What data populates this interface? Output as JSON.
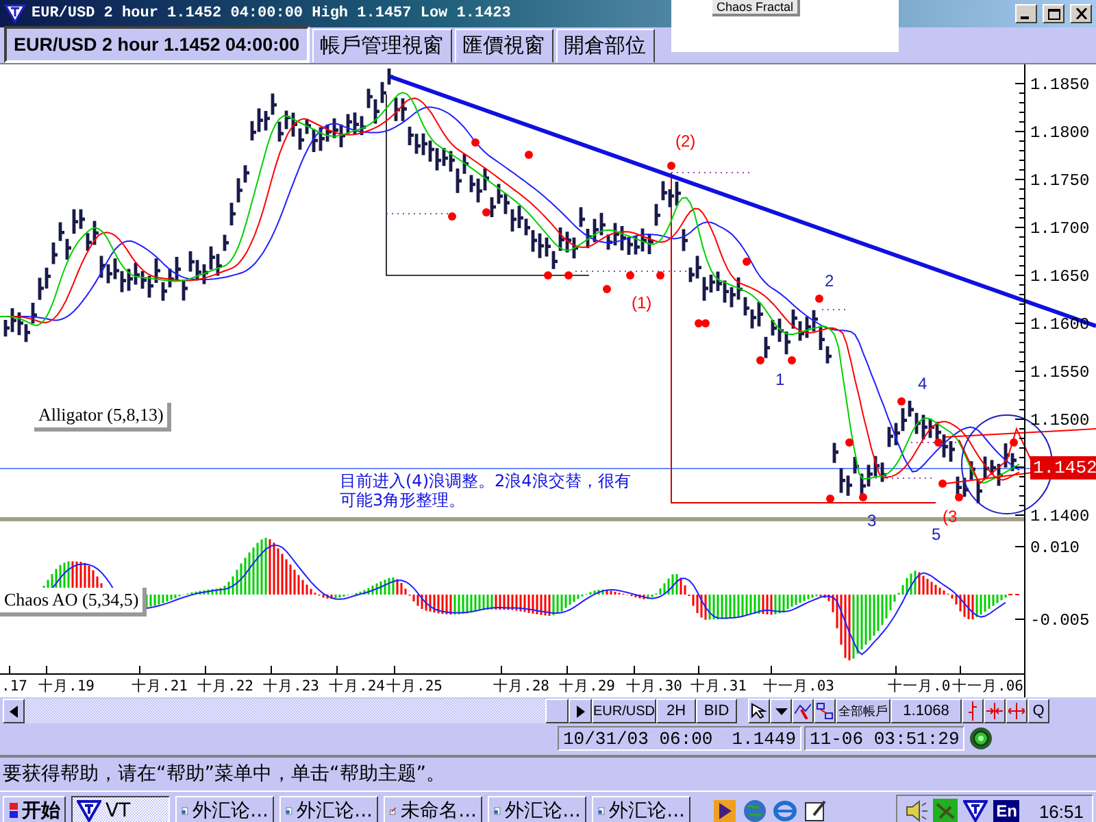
{
  "window": {
    "title": "EUR/USD 2 hour 1.1452 04:00:00 High 1.1457 Low 1.1423"
  },
  "popup": {
    "text": "Chaos Fractal"
  },
  "tabs": [
    {
      "label": "EUR/USD 2 hour 1.1452 04:00:00",
      "selected": true
    },
    {
      "label": "帳戶管理視窗",
      "selected": false
    },
    {
      "label": "匯價視窗",
      "selected": false
    },
    {
      "label": "開倉部位",
      "selected": false
    }
  ],
  "chart": {
    "price_axis": [
      "1.1850",
      "1.1800",
      "1.1750",
      "1.1700",
      "1.1650",
      "1.1600",
      "1.1550",
      "1.1500",
      "1.1400"
    ],
    "last_price": "1.1452",
    "indicator_label": "Alligator (5,8,13)",
    "wave_labels": [
      {
        "text": "(2)",
        "color": "#ff0000"
      },
      {
        "text": "(1)",
        "color": "#ff0000"
      },
      {
        "text": "2",
        "color": "#2020c0"
      },
      {
        "text": "1",
        "color": "#2020c0"
      },
      {
        "text": "3",
        "color": "#2020c0"
      },
      {
        "text": "4",
        "color": "#2020c0"
      },
      {
        "text": "5",
        "color": "#2020c0"
      },
      {
        "text": "(3",
        "color": "#ff0000"
      }
    ],
    "annotation": [
      "目前进入(4)浪调整。2浪4浪交替，很有",
      "可能3角形整理。"
    ]
  },
  "oscillator": {
    "label": "Chaos AO (5,34,5)",
    "axis": [
      "0.010",
      "-0.005"
    ]
  },
  "time_axis": [
    ".17",
    "十月.19",
    "十月.21",
    "十月.22",
    "十月.23",
    "十月.24",
    "十月.25",
    "十月.28",
    "十月.29",
    "十月.30",
    "十月.31",
    "十一月.03",
    "十一月.0",
    "十一月.06"
  ],
  "toolbar": {
    "symbol": "EUR/USD",
    "period": "2H",
    "price_type": "BID",
    "account": "全部帳戶",
    "value": "1.1068",
    "zoom": "Q"
  },
  "status": {
    "cursor_time": "10/31/03 06:00",
    "cursor_price": "1.1449",
    "clock": "11-06 03:51:29"
  },
  "status_bar": {
    "text": "要获得帮助，请在“帮助”菜单中，单击“帮助主题”。"
  },
  "taskbar": {
    "start": "开始",
    "tasks": [
      {
        "label": "VT",
        "kind": "app",
        "selected": true
      },
      {
        "label": "外汇论...",
        "kind": "browser",
        "selected": false
      },
      {
        "label": "外汇论...",
        "kind": "browser",
        "selected": false
      },
      {
        "label": "未命名...",
        "kind": "paint",
        "selected": false
      },
      {
        "label": "外汇论...",
        "kind": "browser",
        "selected": false
      },
      {
        "label": "外汇论...",
        "kind": "browser",
        "selected": false
      }
    ],
    "language": "En",
    "time": "16:51"
  }
}
